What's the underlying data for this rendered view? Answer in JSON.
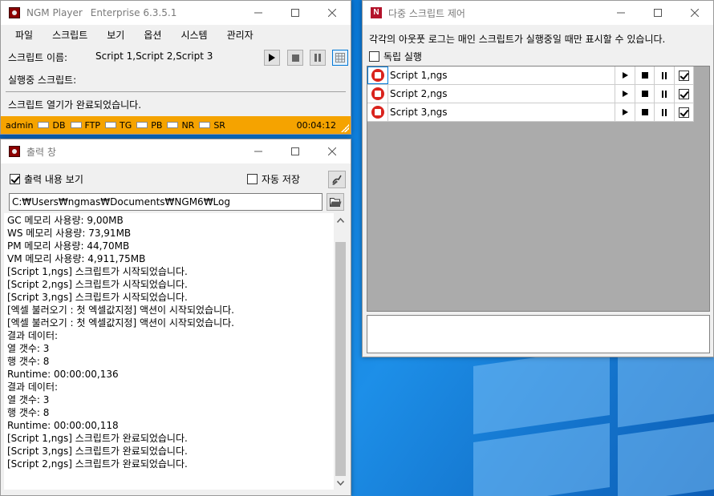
{
  "player": {
    "title": "NGM Player",
    "edition": "Enterprise 6.3.5.1",
    "menu": [
      "파일",
      "스크립트",
      "보기",
      "옵션",
      "시스템",
      "관리자"
    ],
    "script_name_label": "스크립트 이름:",
    "script_name_value": "Script 1,Script 2,Script 3",
    "running_label": "실행중 스크립트:",
    "running_value": "",
    "status_message": "스크립트 열기가 완료되었습니다.",
    "status_bar": {
      "user": "admin",
      "indicators": [
        "DB",
        "FTP",
        "TG",
        "PB",
        "NR",
        "SR"
      ],
      "timer": "00:04:12"
    }
  },
  "output": {
    "title": "출력 창",
    "show_output_label": "출력 내용 보기",
    "show_output_checked": true,
    "auto_save_label": "자동 저장",
    "auto_save_checked": false,
    "log_path": "C:₩Users₩ngmas₩Documents₩NGM6₩Log",
    "lines": [
      "GC 메모리 사용량: 9,00MB",
      "WS 메모리 사용량: 73,91MB",
      "PM 메모리 사용량: 44,70MB",
      "VM 메모리 사용량: 4,911,75MB",
      "[Script 1,ngs] 스크립트가 시작되었습니다.",
      "[Script 2,ngs] 스크립트가 시작되었습니다.",
      "[Script 3,ngs] 스크립트가 시작되었습니다.",
      "[엑셀 불러오기 : 첫 엑셀값지정] 액션이 시작되었습니다.",
      "[엑셀 불러오기 : 첫 엑셀값지정] 액션이 시작되었습니다.",
      "결과 데이터:",
      "열 갯수: 3",
      "행 갯수: 8",
      "Runtime: 00:00:00,136",
      "결과 데이터:",
      "열 갯수: 3",
      "행 갯수: 8",
      "Runtime: 00:00:00,118",
      "[Script 1,ngs] 스크립트가 완료되었습니다.",
      "[Script 3,ngs] 스크립트가 완료되었습니다.",
      "[Script 2,ngs] 스크립트가 완료되었습니다."
    ]
  },
  "multi": {
    "title": "다중 스크립트 제어",
    "info": "각각의 아웃풋 로그는 매인 스크립트가 실행중일 때만 표시할 수 있습니다.",
    "standalone_label": "독립 실행",
    "standalone_checked": false,
    "scripts": [
      {
        "name": "Script 1,ngs",
        "checked": true
      },
      {
        "name": "Script 2,ngs",
        "checked": true
      },
      {
        "name": "Script 3,ngs",
        "checked": true
      }
    ],
    "message": ""
  },
  "icons": {
    "app": "ngm-app-icon",
    "multi_app": "n-app-icon"
  }
}
